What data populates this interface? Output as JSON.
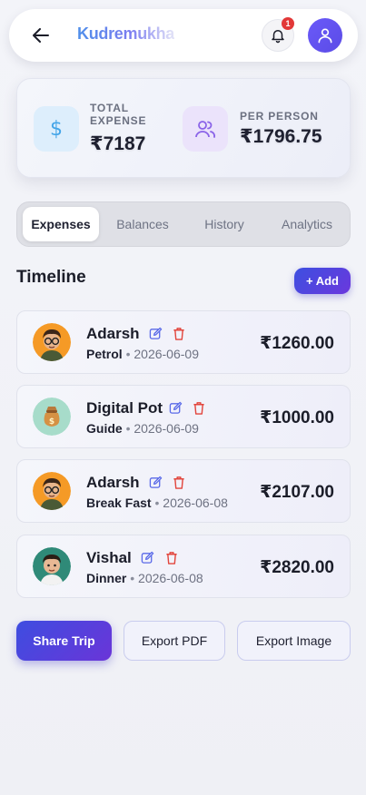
{
  "header": {
    "title": "Kudremukha",
    "notification_count": "1"
  },
  "summary": {
    "total_label": "TOTAL EXPENSE",
    "total_value": "₹7187",
    "per_person_label": "PER PERSON",
    "per_person_value": "₹1796.75"
  },
  "tabs": [
    {
      "label": "Expenses",
      "active": true
    },
    {
      "label": "Balances",
      "active": false
    },
    {
      "label": "History",
      "active": false
    },
    {
      "label": "Analytics",
      "active": false
    }
  ],
  "timeline": {
    "title": "Timeline",
    "add_label": "+ Add",
    "entries": [
      {
        "name": "Adarsh",
        "category": "Petrol",
        "separator": "•",
        "date": "2026-06-09",
        "amount": "₹1260.00",
        "avatar": "boy-glasses-avatar"
      },
      {
        "name": "Digital Pot",
        "category": "Guide",
        "separator": "•",
        "date": "2026-06-09",
        "amount": "₹1000.00",
        "avatar": "money-bag-icon"
      },
      {
        "name": "Adarsh",
        "category": "Break Fast",
        "separator": "•",
        "date": "2026-06-08",
        "amount": "₹2107.00",
        "avatar": "boy-glasses-avatar"
      },
      {
        "name": "Vishal",
        "category": "Dinner",
        "separator": "•",
        "date": "2026-06-08",
        "amount": "₹2820.00",
        "avatar": "boy-avatar"
      }
    ]
  },
  "actions": {
    "share_label": "Share Trip",
    "export_pdf_label": "Export PDF",
    "export_image_label": "Export Image"
  },
  "colors": {
    "accent": "#5b4be6",
    "amount_text": "#1b1d29",
    "delete_red": "#e2453c",
    "edit_blue": "#5a6ae8"
  }
}
